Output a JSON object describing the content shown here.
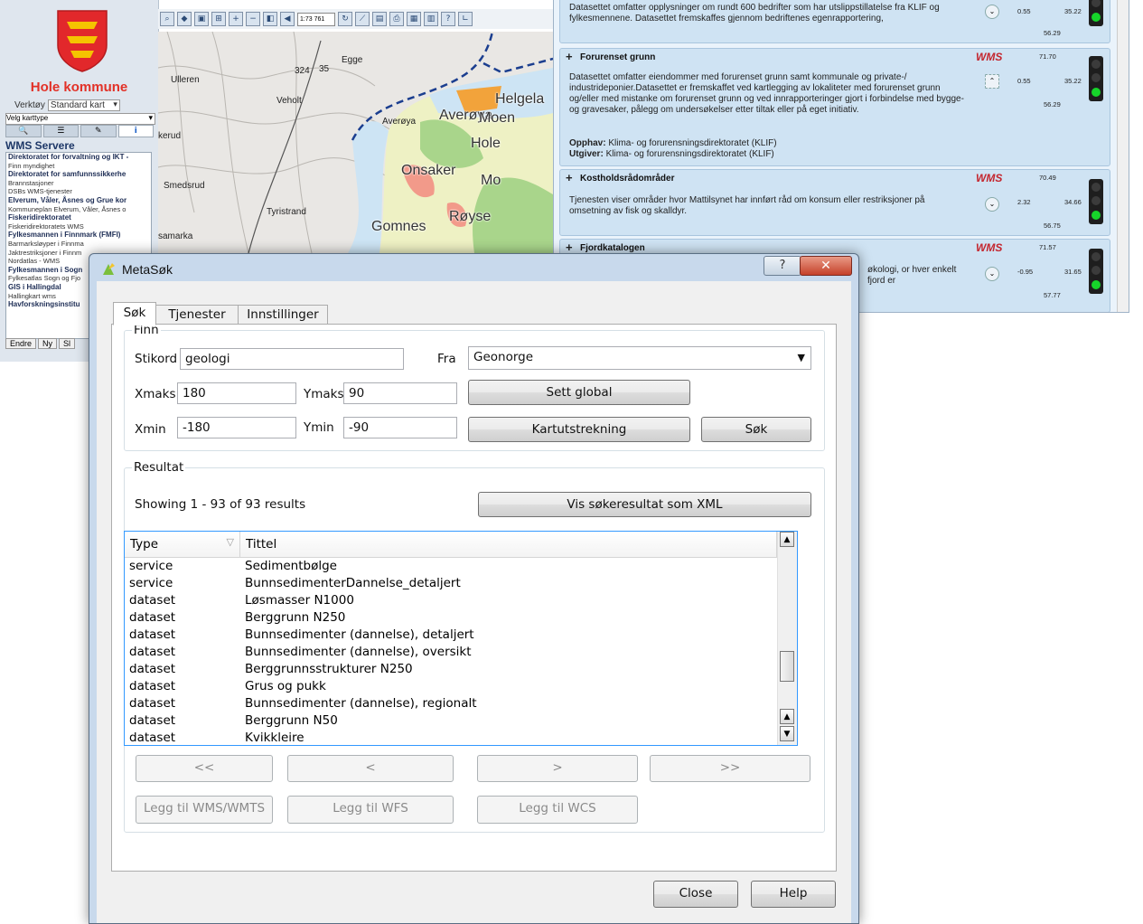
{
  "bg_web": {
    "municipality": "Hole kommune",
    "tool_label": "Verktøy",
    "tool_value": "Standard kart",
    "karttype": "Velg karttype",
    "wms_header": "WMS Servere",
    "wms_list": [
      {
        "text": "Direktoratet for forvaltning og IKT -",
        "bold": true
      },
      {
        "text": "Finn myndighet",
        "bold": false
      },
      {
        "text": "Direktoratet for samfunnssikkerhe",
        "bold": true
      },
      {
        "text": "Brannstasjoner",
        "bold": false
      },
      {
        "text": "DSBs WMS-tjenester",
        "bold": false
      },
      {
        "text": "Elverum, Våler, Åsnes og Grue kor",
        "bold": true
      },
      {
        "text": "Kommuneplan Elverum, Våler, Åsnes o",
        "bold": false
      },
      {
        "text": "Fiskeridirektoratet",
        "bold": true
      },
      {
        "text": "Fiskeridirektoratets WMS",
        "bold": false
      },
      {
        "text": "Fylkesmannen i Finnmark (FMFI)",
        "bold": true
      },
      {
        "text": "Barmarksløyper i Finnma",
        "bold": false
      },
      {
        "text": "Jaktrestriksjoner i Finnm",
        "bold": false
      },
      {
        "text": "Nordatlas - WMS",
        "bold": false
      },
      {
        "text": "Fylkesmannen i Sogn",
        "bold": true
      },
      {
        "text": "Fylkesatlas Sogn og Fjo",
        "bold": false
      },
      {
        "text": "GIS i Hallingdal",
        "bold": true
      },
      {
        "text": "Hallingkart wms",
        "bold": false
      },
      {
        "text": "Havforskningsinstitu",
        "bold": true
      }
    ],
    "btn_endre": "Endre",
    "btn_ny": "Ny",
    "btn_sl": "Sl",
    "scale_value": "1:73 761",
    "map_labels": {
      "egge": "Egge",
      "ulleren": "Ulleren",
      "veholt": "Veholt",
      "averoya_small": "Averøya",
      "averoya": "Averøya",
      "helgelandsmoen": "Helgela",
      "moen": "Moen",
      "hole": "Hole",
      "kerud": "kerud",
      "onsaker": "Onsaker",
      "mo": "Mo",
      "smedsrud": "Smedsrud",
      "tyristrand": "Tyristrand",
      "royse": "Røyse",
      "gomnes": "Gomnes",
      "samarka": "samarka",
      "road_324": "324",
      "road_35": "35"
    },
    "cards": [
      {
        "title": "",
        "desc": "Datasettet omfatter opplysninger om rundt 600 bedrifter som har utslippstillatelse fra KLIF og fylkesmennene. Datasettet fremskaffes gjennom bedriftenes egenrapportering,",
        "n_left": "0.55",
        "n_right": "35.22",
        "n_bottom": "56.29",
        "wms": ""
      },
      {
        "title": "Forurenset grunn",
        "desc": "Datasettet omfatter eiendommer med forurenset grunn samt kommunale og private-/ industrideponier.Datasettet er fremskaffet ved kartlegging av lokaliteter med forurenset grunn og/eller med mistanke om forurenset grunn og ved innrapporteringer gjort i forbindelse med bygge- og gravesaker, pålegg om undersøkelser etter tiltak eller på eget initiativ.",
        "opphav_label": "Opphav:",
        "opphav": "Klima- og forurensningsdirektoratet (KLIF)",
        "utgiver_label": "Utgiver:",
        "utgiver": "Klima- og forurensningsdirektoratet (KLIF)",
        "n_top": "71.70",
        "n_left": "0.55",
        "n_right": "35.22",
        "n_bottom": "56.29",
        "wms": "WMS"
      },
      {
        "title": "Kostholdsrådområder",
        "desc": "Tjenesten viser områder hvor Mattilsynet har innført råd om konsum eller restriksjoner på omsetning av fisk og skalldyr.",
        "n_top": "70.49",
        "n_left": "2.32",
        "n_right": "34.66",
        "n_bottom": "56.75",
        "wms": "WMS"
      },
      {
        "title": "Fjordkatalogen",
        "desc": "økologi, or hver enkelt fjord er",
        "n_top": "71.57",
        "n_left": "-0.95",
        "n_right": "31.65",
        "n_bottom": "57.77",
        "wms": "WMS"
      }
    ]
  },
  "dialog": {
    "title": "MetaSøk",
    "titlebar_help": "?",
    "titlebar_close": "✕",
    "tabs": [
      "Søk",
      "Tjenester",
      "Innstillinger"
    ],
    "finn": {
      "legend": "Finn",
      "stikord_label": "Stikord",
      "stikord_value": "geologi",
      "fra_label": "Fra",
      "fra_value": "Geonorge",
      "xmaks_label": "Xmaks",
      "xmaks_value": "180",
      "ymaks_label": "Ymaks",
      "ymaks_value": "90",
      "xmin_label": "Xmin",
      "xmin_value": "-180",
      "ymin_label": "Ymin",
      "ymin_value": "-90",
      "sett_global": "Sett global",
      "kartutstrekning": "Kartutstrekning",
      "sok": "Søk"
    },
    "resultat": {
      "legend": "Resultat",
      "showing": "Showing 1 - 93 of 93 results",
      "vis_xml": "Vis søkeresultat som XML",
      "col_type": "Type",
      "col_tittel": "Tittel",
      "rows": [
        {
          "type": "service",
          "tittel": "Sedimentbølge"
        },
        {
          "type": "service",
          "tittel": "BunnsedimenterDannelse_detaljert"
        },
        {
          "type": "dataset",
          "tittel": "Løsmasser N1000"
        },
        {
          "type": "dataset",
          "tittel": "Berggrunn N250"
        },
        {
          "type": "dataset",
          "tittel": "Bunnsedimenter (dannelse), detaljert"
        },
        {
          "type": "dataset",
          "tittel": "Bunnsedimenter (dannelse), oversikt"
        },
        {
          "type": "dataset",
          "tittel": "Berggrunnsstrukturer N250"
        },
        {
          "type": "dataset",
          "tittel": "Grus og pukk"
        },
        {
          "type": "dataset",
          "tittel": "Bunnsedimenter (dannelse), regionalt"
        },
        {
          "type": "dataset",
          "tittel": "Berggrunn N50"
        },
        {
          "type": "dataset",
          "tittel": "Kvikkleire"
        }
      ],
      "nav_first": "<<",
      "nav_prev": "<",
      "nav_next": ">",
      "nav_last": ">>",
      "add_wms": "Legg til WMS/WMTS",
      "add_wfs": "Legg til WFS",
      "add_wcs": "Legg til WCS"
    },
    "close": "Close",
    "help": "Help"
  }
}
